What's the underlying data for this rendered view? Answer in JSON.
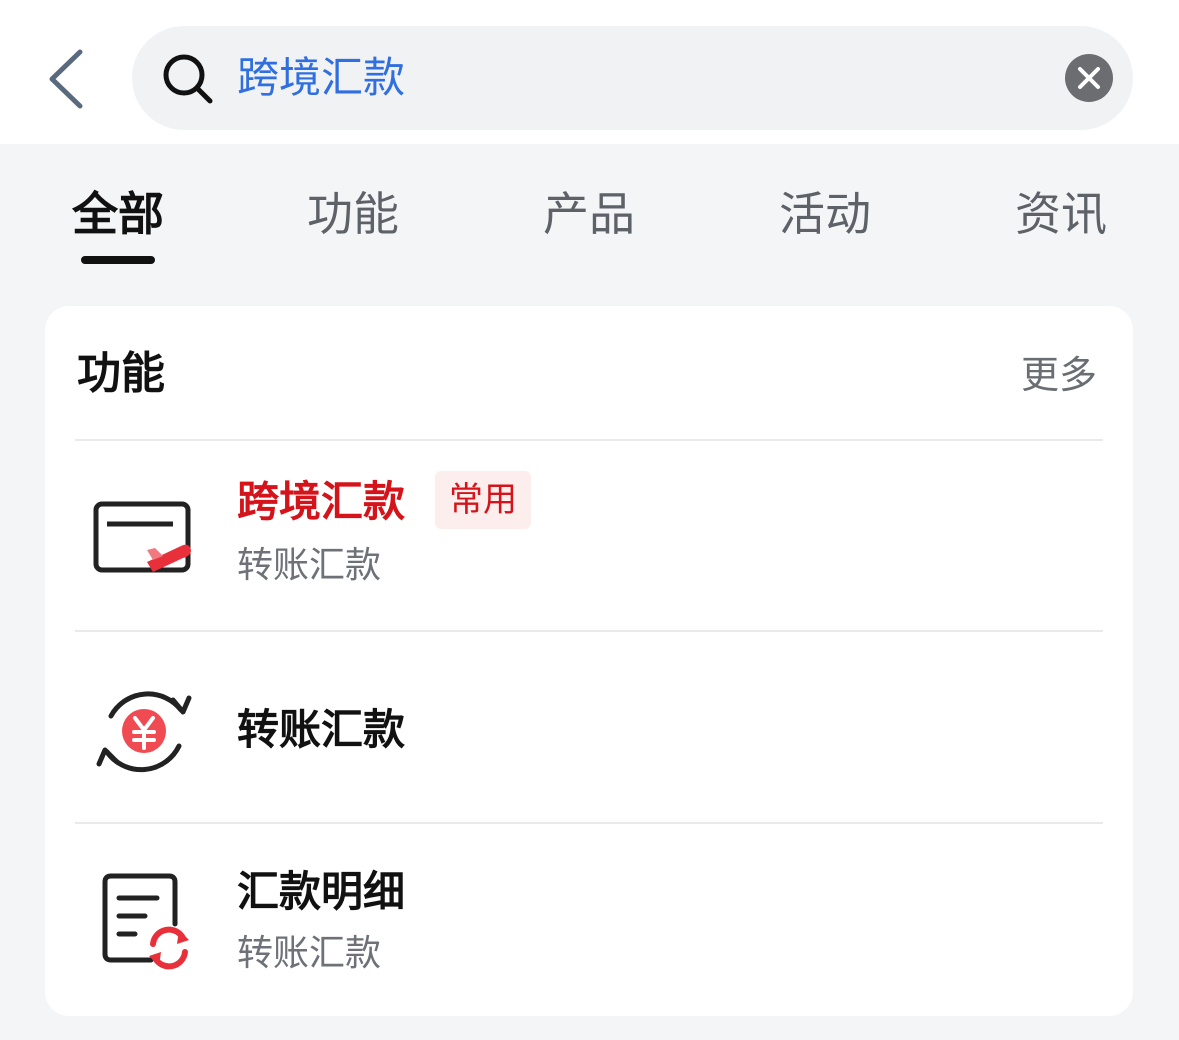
{
  "search": {
    "query": "跨境汇款",
    "back_icon": "chevron-left-icon",
    "search_icon": "search-icon",
    "clear_icon": "clear-icon"
  },
  "tabs": [
    {
      "label": "全部",
      "active": true
    },
    {
      "label": "功能",
      "active": false
    },
    {
      "label": "产品",
      "active": false
    },
    {
      "label": "活动",
      "active": false
    },
    {
      "label": "资讯",
      "active": false
    }
  ],
  "section": {
    "title": "功能",
    "more_label": "更多",
    "items": [
      {
        "title": "跨境汇款",
        "badge": "常用",
        "subtitle": "转账汇款",
        "icon": "cross-border-card-icon",
        "highlighted": true
      },
      {
        "title": "转账汇款",
        "subtitle": "",
        "icon": "yuan-transfer-icon",
        "highlighted": false
      },
      {
        "title": "汇款明细",
        "subtitle": "转账汇款",
        "icon": "remittance-details-icon",
        "highlighted": false
      }
    ]
  },
  "colors": {
    "accent_red": "#d4141a",
    "search_blue": "#2f6fe0",
    "page_bg": "#f4f5f7",
    "active_tab": "#111111"
  }
}
